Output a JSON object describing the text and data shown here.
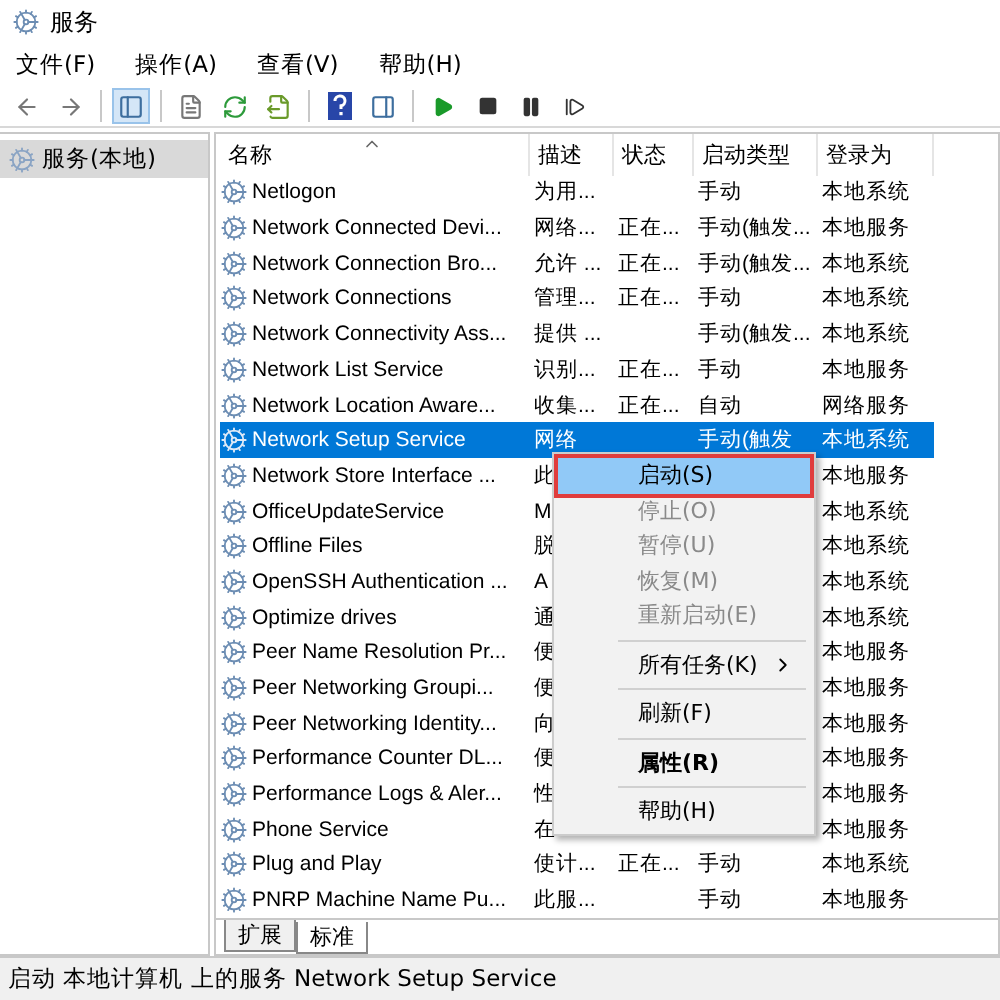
{
  "window": {
    "title": "服务"
  },
  "menu": [
    "文件(F)",
    "操作(A)",
    "查看(V)",
    "帮助(H)"
  ],
  "toolbar": [
    {
      "kind": "back"
    },
    {
      "kind": "forward"
    },
    {
      "kind": "sep"
    },
    {
      "kind": "tree",
      "selected": true
    },
    {
      "kind": "sep"
    },
    {
      "kind": "props",
      "selected": false
    },
    {
      "kind": "refresh",
      "selected": false
    },
    {
      "kind": "export",
      "selected": false
    },
    {
      "kind": "sep"
    },
    {
      "kind": "help",
      "selected": false
    },
    {
      "kind": "pane",
      "selected": false
    },
    {
      "kind": "sep"
    },
    {
      "kind": "play",
      "selected": false
    },
    {
      "kind": "stop",
      "selected": false
    },
    {
      "kind": "pause",
      "selected": false
    },
    {
      "kind": "restart",
      "selected": false
    }
  ],
  "tree": {
    "items": [
      {
        "label": "服务(本地)",
        "selected": true
      }
    ]
  },
  "table": {
    "columns": [
      "名称",
      "描述",
      "状态",
      "启动类型",
      "登录为"
    ],
    "rows": [
      {
        "name": "Netlogon",
        "desc": "为用...",
        "status": "",
        "startup": "手动",
        "logon": "本地系统",
        "selected": false
      },
      {
        "name": "Network Connected Devi...",
        "desc": "网络...",
        "status": "正在...",
        "startup": "手动(触发...",
        "logon": "本地服务",
        "selected": false
      },
      {
        "name": "Network Connection Bro...",
        "desc": "允许 ...",
        "status": "正在...",
        "startup": "手动(触发...",
        "logon": "本地系统",
        "selected": false
      },
      {
        "name": "Network Connections",
        "desc": "管理...",
        "status": "正在...",
        "startup": "手动",
        "logon": "本地系统",
        "selected": false
      },
      {
        "name": "Network Connectivity Ass...",
        "desc": "提供 ...",
        "status": "",
        "startup": "手动(触发...",
        "logon": "本地系统",
        "selected": false
      },
      {
        "name": "Network List Service",
        "desc": "识别...",
        "status": "正在...",
        "startup": "手动",
        "logon": "本地服务",
        "selected": false
      },
      {
        "name": "Network Location Aware...",
        "desc": "收集...",
        "status": "正在...",
        "startup": "自动",
        "logon": "网络服务",
        "selected": false
      },
      {
        "name": "Network Setup Service",
        "desc": "网络",
        "status": "",
        "startup": "手动(触发",
        "logon": "本地系统",
        "selected": true
      },
      {
        "name": "Network Store Interface ...",
        "desc": "此",
        "status": "",
        "startup": "",
        "logon": "本地服务",
        "selected": false
      },
      {
        "name": "OfficeUpdateService",
        "desc": "M",
        "status": "",
        "startup": "",
        "logon": "本地系统",
        "selected": false
      },
      {
        "name": "Offline Files",
        "desc": "脱",
        "status": "",
        "startup": "",
        "logon": "本地系统",
        "selected": false
      },
      {
        "name": "OpenSSH Authentication ...",
        "desc": "A",
        "status": "",
        "startup": "",
        "logon": "本地系统",
        "selected": false
      },
      {
        "name": "Optimize drives",
        "desc": "通",
        "status": "",
        "startup": "",
        "logon": "本地系统",
        "selected": false
      },
      {
        "name": "Peer Name Resolution Pr...",
        "desc": "便",
        "status": "",
        "startup": "",
        "logon": "本地服务",
        "selected": false
      },
      {
        "name": "Peer Networking Groupi...",
        "desc": "便",
        "status": "",
        "startup": "",
        "logon": "本地服务",
        "selected": false
      },
      {
        "name": "Peer Networking Identity...",
        "desc": "向",
        "status": "",
        "startup": "",
        "logon": "本地服务",
        "selected": false
      },
      {
        "name": "Performance Counter DL...",
        "desc": "便",
        "status": "",
        "startup": "",
        "logon": "本地服务",
        "selected": false
      },
      {
        "name": "Performance Logs & Aler...",
        "desc": "性",
        "status": "",
        "startup": "",
        "logon": "本地服务",
        "selected": false
      },
      {
        "name": "Phone Service",
        "desc": "在",
        "status": "",
        "startup": "",
        "logon": "本地服务",
        "selected": false
      },
      {
        "name": "Plug and Play",
        "desc": "使计...",
        "status": "正在...",
        "startup": "手动",
        "logon": "本地系统",
        "selected": false
      },
      {
        "name": "PNRP Machine Name Pu...",
        "desc": "此服...",
        "status": "",
        "startup": "手动",
        "logon": "本地服务",
        "selected": false
      }
    ]
  },
  "tabs": [
    {
      "label": "扩展",
      "selected": false
    },
    {
      "label": "标准",
      "selected": true
    }
  ],
  "context_menu": {
    "items": [
      {
        "label": "启动(S)",
        "disabled": false,
        "selected": true,
        "bold": false,
        "submenu": false,
        "separator_before": false
      },
      {
        "label": "停止(O)",
        "disabled": true,
        "selected": false,
        "bold": false,
        "submenu": false,
        "separator_before": false
      },
      {
        "label": "暂停(U)",
        "disabled": true,
        "selected": false,
        "bold": false,
        "submenu": false,
        "separator_before": false
      },
      {
        "label": "恢复(M)",
        "disabled": true,
        "selected": false,
        "bold": false,
        "submenu": false,
        "separator_before": false
      },
      {
        "label": "重新启动(E)",
        "disabled": true,
        "selected": false,
        "bold": false,
        "submenu": false,
        "separator_before": false
      },
      {
        "label": "所有任务(K)",
        "disabled": false,
        "selected": false,
        "bold": false,
        "submenu": true,
        "separator_before": true
      },
      {
        "label": "刷新(F)",
        "disabled": false,
        "selected": false,
        "bold": false,
        "submenu": false,
        "separator_before": true
      },
      {
        "label": "属性(R)",
        "disabled": false,
        "selected": false,
        "bold": true,
        "submenu": false,
        "separator_before": true
      },
      {
        "label": "帮助(H)",
        "disabled": false,
        "selected": false,
        "bold": false,
        "submenu": false,
        "separator_before": true
      }
    ]
  },
  "status_bar": "启动 本地计算机 上的服务 Network Setup Service"
}
